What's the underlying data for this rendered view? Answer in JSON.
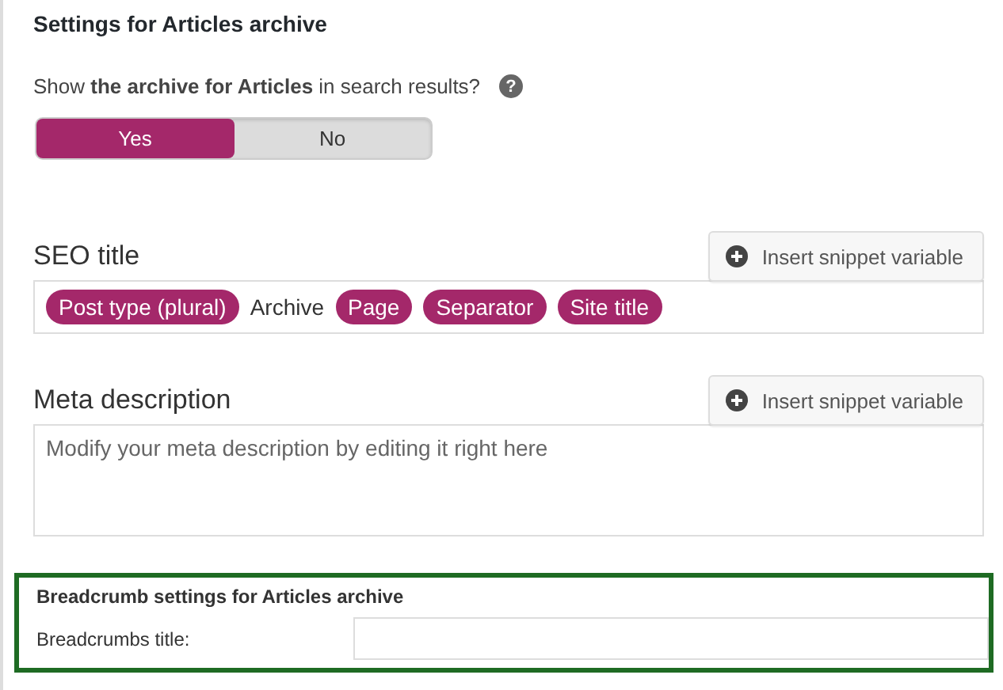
{
  "heading": "Settings for Articles archive",
  "search_question": {
    "text": "Show **the archive for Articles** in search results?",
    "help": "?"
  },
  "toggle": [
    {
      "label": "Yes",
      "selected": true
    },
    {
      "label": "No",
      "selected": false
    }
  ],
  "seo_title": {
    "label": "SEO title",
    "button": "Insert snippet variable",
    "parts": [
      {
        "kind": "variable",
        "text": "Post type (plural)"
      },
      {
        "kind": "text",
        "text": "Archive"
      },
      {
        "kind": "variable",
        "text": "Page"
      },
      {
        "kind": "variable",
        "text": "Separator"
      },
      {
        "kind": "variable",
        "text": "Site title"
      }
    ]
  },
  "meta_description": {
    "label": "Meta description",
    "button": "Insert snippet variable",
    "placeholder": "Modify your meta description by editing it right here"
  },
  "breadcrumbs": {
    "heading": "Breadcrumb settings for Articles archive",
    "label": "Breadcrumbs title:"
  }
}
